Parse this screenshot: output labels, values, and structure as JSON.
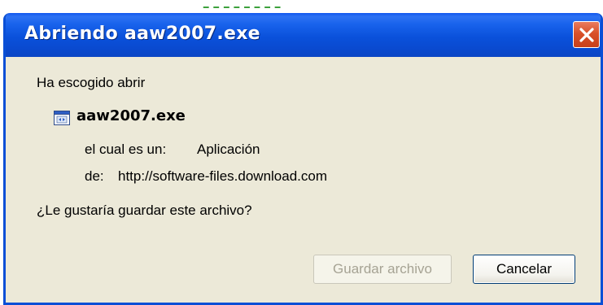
{
  "dialog": {
    "title": "Abriendo aaw2007.exe",
    "intro": "Ha escogido abrir",
    "file": {
      "name": "aaw2007.exe",
      "type_label": "el cual es un:",
      "type_value": "Aplicación",
      "from_label": "de:",
      "from_value": "http://software-files.download.com"
    },
    "question": "¿Le gustaría guardar este archivo?",
    "buttons": {
      "save": "Guardar archivo",
      "cancel": "Cancelar"
    }
  },
  "icons": {
    "close": "close-icon",
    "file": "executable-file-icon"
  },
  "colors": {
    "titlebar": "#0a51db",
    "close_button": "#d9512a",
    "dialog_bg": "#ece9d8"
  }
}
